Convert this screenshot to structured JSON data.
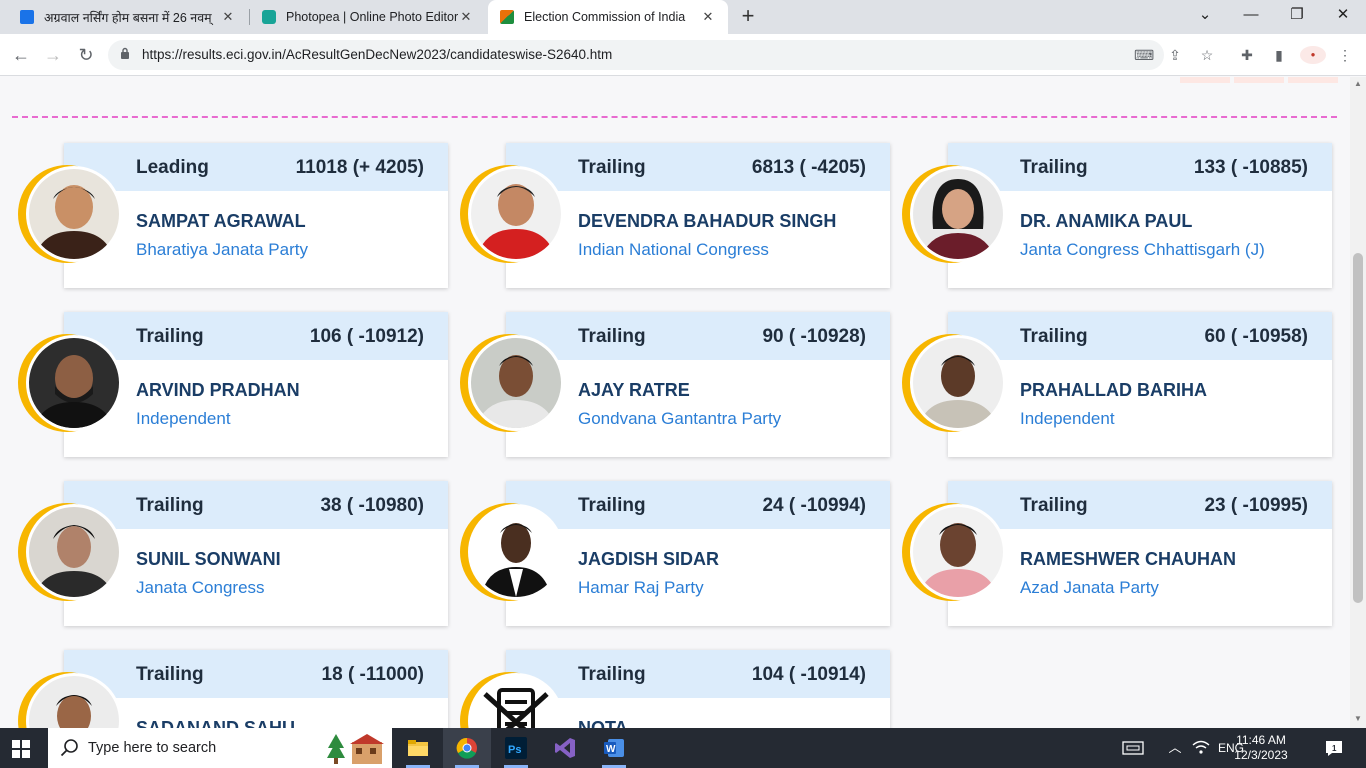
{
  "browser": {
    "tabs": [
      {
        "title": "अग्रवाल नर्सिंग होम बसना में 26 नवम्",
        "favicon_color": "#1a73e8",
        "active": false
      },
      {
        "title": "Photopea | Online Photo Editor",
        "favicon_color": "#18a497",
        "active": false
      },
      {
        "title": "Election Commission of India",
        "favicon_color": "#e8710a",
        "active": true
      }
    ],
    "url": "https://results.eci.gov.in/AcResultGenDecNew2023/candidateswise-S2640.htm"
  },
  "colors": {
    "card_header": "#dcecfb",
    "name": "#1a3d66",
    "party": "#2b7ed6",
    "ring": "#f7b600",
    "dash_line": "#e86ad0"
  },
  "candidates": [
    {
      "status": "Leading",
      "votes": "11018 (+ 4205)",
      "name": "SAMPAT AGRAWAL",
      "party": "Bharatiya Janata Party"
    },
    {
      "status": "Trailing",
      "votes": "6813 ( -4205)",
      "name": "DEVENDRA BAHADUR SINGH",
      "party": "Indian National Congress"
    },
    {
      "status": "Trailing",
      "votes": "133 ( -10885)",
      "name": "DR. ANAMIKA PAUL",
      "party": "Janta Congress Chhattisgarh (J)"
    },
    {
      "status": "Trailing",
      "votes": "106 ( -10912)",
      "name": "ARVIND PRADHAN",
      "party": "Independent"
    },
    {
      "status": "Trailing",
      "votes": "90 ( -10928)",
      "name": "AJAY RATRE",
      "party": "Gondvana Gantantra Party"
    },
    {
      "status": "Trailing",
      "votes": "60 ( -10958)",
      "name": "PRAHALLAD BARIHA",
      "party": "Independent"
    },
    {
      "status": "Trailing",
      "votes": "38 ( -10980)",
      "name": "SUNIL SONWANI",
      "party": "Janata Congress"
    },
    {
      "status": "Trailing",
      "votes": "24 ( -10994)",
      "name": "JAGDISH SIDAR",
      "party": "Hamar Raj Party"
    },
    {
      "status": "Trailing",
      "votes": "23 ( -10995)",
      "name": "RAMESHWER CHAUHAN",
      "party": "Azad Janata Party"
    },
    {
      "status": "Trailing",
      "votes": "18 ( -11000)",
      "name": "SADANAND SAHU",
      "party": ""
    },
    {
      "status": "Trailing",
      "votes": "104 ( -10914)",
      "name": "NOTA",
      "party": ""
    }
  ],
  "taskbar": {
    "search_placeholder": "Type here to search",
    "language": "ENG",
    "time": "11:46 AM",
    "date": "12/3/2023"
  }
}
